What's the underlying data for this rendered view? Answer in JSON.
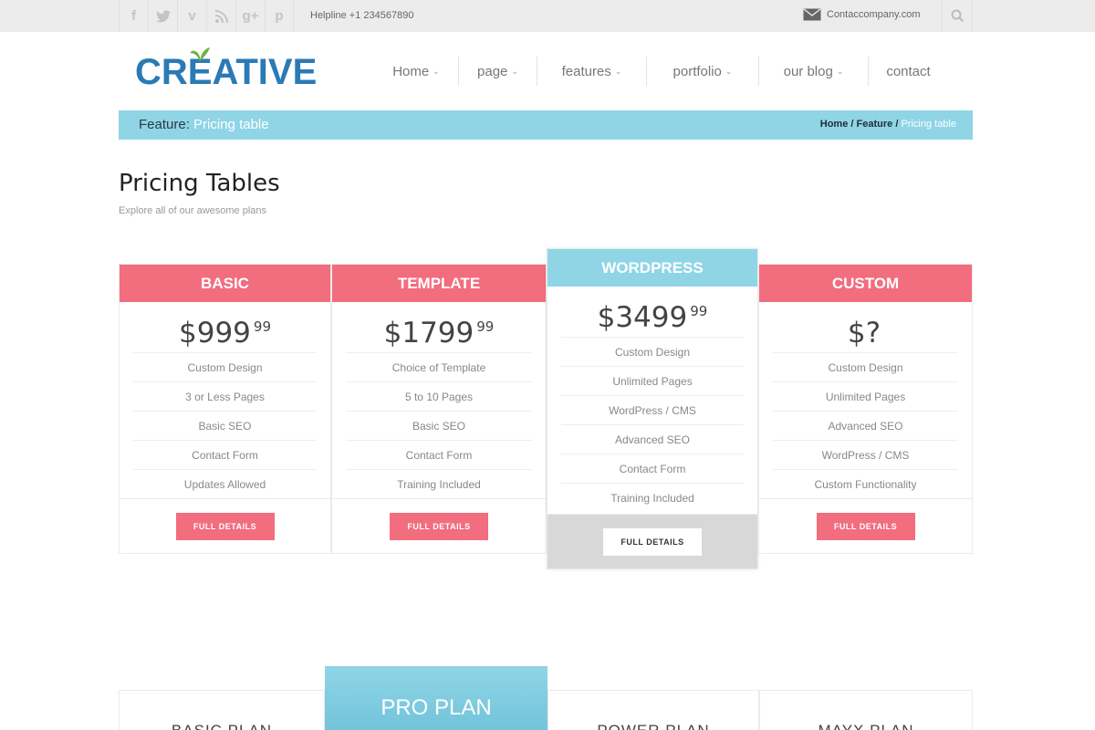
{
  "topbar": {
    "social": [
      {
        "name": "facebook-icon",
        "glyph": "f"
      },
      {
        "name": "twitter-icon",
        "glyph": "t"
      },
      {
        "name": "vimeo-icon",
        "glyph": "v"
      },
      {
        "name": "rss-icon",
        "glyph": "r"
      },
      {
        "name": "googleplus-icon",
        "glyph": "g+"
      },
      {
        "name": "pinterest-icon",
        "glyph": "p"
      }
    ],
    "helpline": "Helpline +1 234567890",
    "email": "Contaccompany.com"
  },
  "header": {
    "logo_text": "CREATIVE",
    "nav": [
      {
        "label": "Home",
        "dropdown": true
      },
      {
        "label": "page",
        "dropdown": true
      },
      {
        "label": "features",
        "dropdown": true
      },
      {
        "label": "portfolio",
        "dropdown": true
      },
      {
        "label": "our blog",
        "dropdown": true
      },
      {
        "label": "contact",
        "dropdown": false
      }
    ]
  },
  "breadcrumb": {
    "section": "Feature:",
    "current": "Pricing table",
    "trail": [
      "Home",
      "Feature"
    ],
    "trail_sep": "/",
    "trail_current": "Pricing table"
  },
  "page": {
    "title": "Pricing Tables",
    "subtitle": "Explore all of our awesome plans"
  },
  "plans": [
    {
      "name": "BASIC",
      "price": "$999",
      "cents": "99",
      "features": [
        "Custom Design",
        "3 or Less Pages",
        "Basic SEO",
        "Contact Form",
        "Updates Allowed"
      ],
      "button": "FULL DETAILS",
      "featured": false
    },
    {
      "name": "TEMPLATE",
      "price": "$1799",
      "cents": "99",
      "features": [
        "Choice of Template",
        "5 to 10 Pages",
        "Basic SEO",
        "Contact Form",
        "Training Included"
      ],
      "button": "FULL DETAILS",
      "featured": false
    },
    {
      "name": "WORDPRESS",
      "price": "$3499",
      "cents": "99",
      "features": [
        "Custom Design",
        "Unlimited Pages",
        "WordPress / CMS",
        "Advanced SEO",
        "Contact Form",
        "Training Included"
      ],
      "button": "FULL DETAILS",
      "featured": true
    },
    {
      "name": "CUSTOM",
      "price": "$?",
      "cents": "",
      "features": [
        "Custom Design",
        "Unlimited Pages",
        "Advanced SEO",
        "WordPress / CMS",
        "Custom Functionality"
      ],
      "button": "FULL DETAILS",
      "featured": false
    }
  ],
  "plans2": {
    "basic": "BASIC PLAN",
    "pro": "PRO PLAN",
    "power": "POWER PLAN",
    "mayx": "MAYX PLAN"
  },
  "colors": {
    "accent_pink": "#f26d7d",
    "accent_blue": "#8fd5e6",
    "logo_blue": "#2a7ab6",
    "leaf_green": "#6db33f"
  }
}
